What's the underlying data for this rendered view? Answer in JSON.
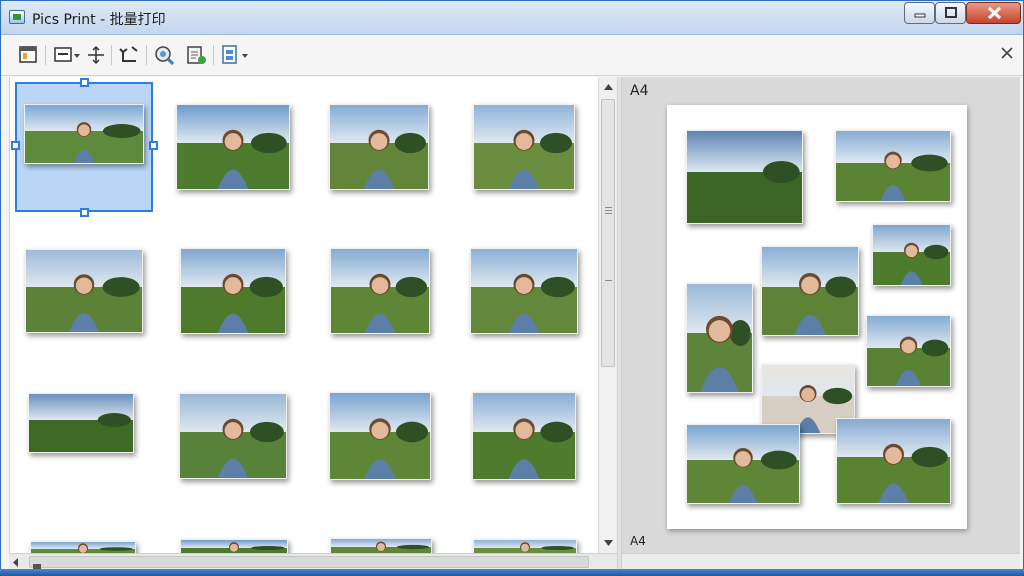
{
  "window": {
    "title": "Pics Print - 批量打印",
    "minimize_icon": "minimize-icon",
    "maximize_icon": "maximize-icon",
    "close_icon": "close-icon"
  },
  "toolbar": {
    "icons": [
      "layout-icon",
      "view-menu-icon",
      "fit-icon",
      "rotate-icon",
      "search-icon",
      "print-settings-icon",
      "page-layout-icon"
    ],
    "close_icon": "close-icon"
  },
  "preview": {
    "paper_label_top": "A4",
    "paper_label_bottom": "A4"
  },
  "colors": {
    "selection": "#2f7de0",
    "selection_fill": "#b9d6f6",
    "titlebar": "#c3d6ee",
    "close_button": "#c7432b"
  },
  "thumbnails": [
    {
      "scene": "sunset-field",
      "sky": "#7aa7d3",
      "ground": "#5f8a3b",
      "person": true
    },
    {
      "scene": "boy-in-field",
      "sky": "#6d9ccc",
      "ground": "#4e7c2f",
      "person": true
    },
    {
      "scene": "woman-in-field",
      "sky": "#85acd6",
      "ground": "#63853a",
      "person": true
    },
    {
      "scene": "two-women",
      "sky": "#8fb3d9",
      "ground": "#6b8d3f",
      "person": true
    },
    {
      "scene": "girl-with-trees",
      "sky": "#9dbad8",
      "ground": "#5b8236",
      "person": true
    },
    {
      "scene": "girl-sitting",
      "sky": "#7fa6d0",
      "ground": "#4f7a2c",
      "person": true
    },
    {
      "scene": "girl-grass",
      "sky": "#84aad2",
      "ground": "#5f8537",
      "person": true
    },
    {
      "scene": "woman-smiling",
      "sky": "#8bb0d6",
      "ground": "#63883b",
      "person": true
    },
    {
      "scene": "landscape-sunset",
      "sky": "#6a8fbc",
      "ground": "#3f6a26",
      "person": false
    },
    {
      "scene": "girl-lying",
      "sky": "#9ab7d4",
      "ground": "#58813a",
      "person": true
    },
    {
      "scene": "woman-sitting",
      "sky": "#7ba3cf",
      "ground": "#5d8637",
      "person": true
    },
    {
      "scene": "boy-smiling",
      "sky": "#88add5",
      "ground": "#4e7b2e",
      "person": true
    }
  ],
  "layout_photos": [
    {
      "scene": "landscape-field",
      "sky": "#5d84b3",
      "ground": "#3c6425",
      "person": false
    },
    {
      "scene": "woman-standing",
      "sky": "#87acd4",
      "ground": "#5a8333",
      "person": true
    },
    {
      "scene": "woman-field",
      "sky": "#8aaed5",
      "ground": "#5d8436",
      "person": true
    },
    {
      "scene": "girl-sitting",
      "sky": "#7fa5cf",
      "ground": "#4f7b2d",
      "person": true
    },
    {
      "scene": "legs-field",
      "sky": "#9bb8d7",
      "ground": "#5d843a",
      "person": true
    },
    {
      "scene": "girl-sitting-2",
      "sky": "#86abd3",
      "ground": "#5a8235",
      "person": true
    },
    {
      "scene": "toddler-curls",
      "sky": "#e9e4dd",
      "ground": "#d8cfc4",
      "person": true
    },
    {
      "scene": "girl-field",
      "sky": "#7ba3cf",
      "ground": "#5f8637",
      "person": true
    },
    {
      "scene": "woman-sitting-grass",
      "sky": "#86aad2",
      "ground": "#5a8233",
      "person": true
    }
  ]
}
